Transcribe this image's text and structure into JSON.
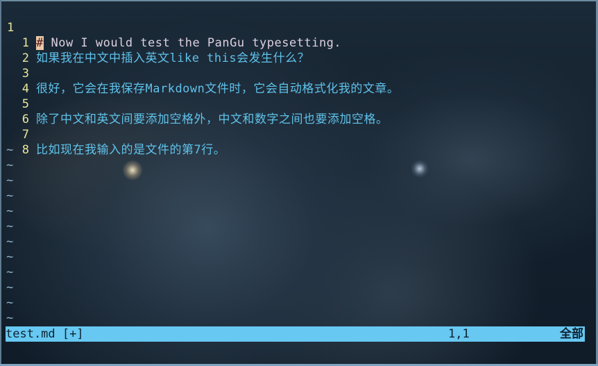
{
  "editor": {
    "lines": [
      {
        "num": "1",
        "text": "# Now I would test the PanGu typesetting.",
        "cursor_char": "#",
        "rest": " Now I would test the PanGu typesetting."
      },
      {
        "num": "1",
        "text": "如果我在中文中插入英文like this会发生什么？"
      },
      {
        "num": "2",
        "text": ""
      },
      {
        "num": "3",
        "text": "很好，它会在我保存Markdown文件时，它会自动格式化我的文章。"
      },
      {
        "num": "4",
        "text": ""
      },
      {
        "num": "5",
        "text": "除了中文和英文间要添加空格外，中文和数字之间也要添加空格。"
      },
      {
        "num": "6",
        "text": ""
      },
      {
        "num": "7",
        "text": "比如现在我输入的是文件的第7行。"
      },
      {
        "num": "8",
        "text": ""
      }
    ],
    "filler": "~"
  },
  "statusline": {
    "filename": "test.md [+]",
    "position": "1,1",
    "scroll": "全部"
  },
  "colors": {
    "text": "#5fc2ea",
    "line_number": "#e8e79a",
    "statusline_bg": "#67c8f2"
  }
}
